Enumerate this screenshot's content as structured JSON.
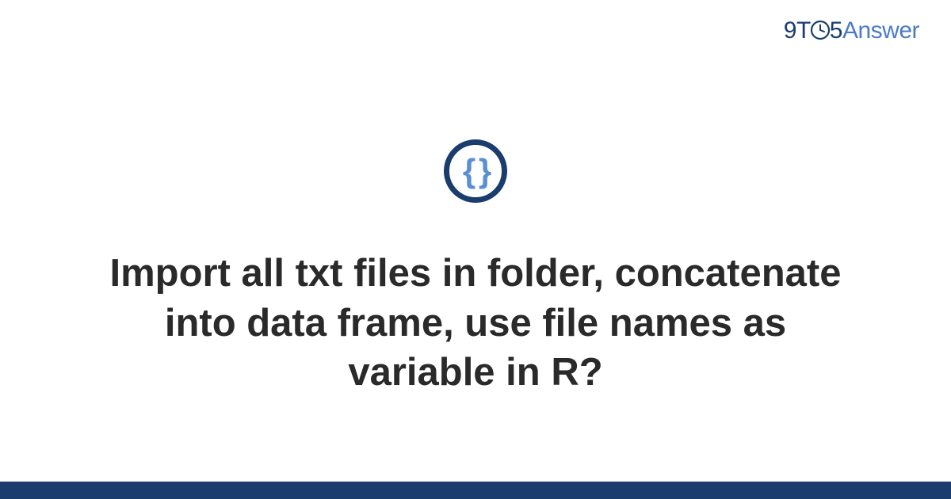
{
  "brand": {
    "nine": "9",
    "t": "T",
    "five": "5",
    "answer": "Answer"
  },
  "icon": {
    "braces": "{ }"
  },
  "title": "Import all txt files in folder, concatenate into data frame, use file names as variable in R?",
  "colors": {
    "brand_dark": "#1a3d6d",
    "brand_light": "#4a7bc8",
    "icon_braces": "#5a8fd4",
    "text": "#2a2a2a"
  }
}
